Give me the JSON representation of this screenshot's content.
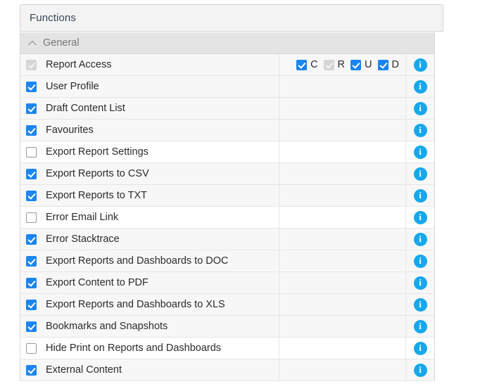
{
  "panel": {
    "title": "Functions"
  },
  "group": {
    "label": "General",
    "collapse_icon": "chevron-up-icon",
    "expanded": true
  },
  "columns": {
    "name": "",
    "permissions": "",
    "info": ""
  },
  "colors": {
    "accent_checkbox": "#1b85f3",
    "info_icon": "#16a7ec",
    "disabled_checkbox": "#d5d5d5",
    "row_shaded": "#f7f7f7",
    "group_header_bg": "#e4e4e4",
    "panel_header_bg": "#f3f3f3",
    "text": "#2b2b2b",
    "title_text": "#33475b"
  },
  "info_icon_label": "i",
  "rows": [
    {
      "label": "Report Access",
      "checked": true,
      "disabled": true,
      "shaded": true,
      "crud": [
        {
          "letter": "C",
          "checked": true,
          "disabled": false
        },
        {
          "letter": "R",
          "checked": true,
          "disabled": true
        },
        {
          "letter": "U",
          "checked": true,
          "disabled": false
        },
        {
          "letter": "D",
          "checked": true,
          "disabled": false
        }
      ],
      "info": true
    },
    {
      "label": "User Profile",
      "checked": true,
      "disabled": false,
      "shaded": true,
      "crud": [],
      "info": true
    },
    {
      "label": "Draft Content List",
      "checked": true,
      "disabled": false,
      "shaded": true,
      "crud": [],
      "info": true
    },
    {
      "label": "Favourites",
      "checked": true,
      "disabled": false,
      "shaded": true,
      "crud": [],
      "info": true
    },
    {
      "label": "Export Report Settings",
      "checked": false,
      "disabled": false,
      "shaded": false,
      "crud": [],
      "info": true
    },
    {
      "label": "Export Reports to CSV",
      "checked": true,
      "disabled": false,
      "shaded": true,
      "crud": [],
      "info": true
    },
    {
      "label": "Export Reports to TXT",
      "checked": true,
      "disabled": false,
      "shaded": true,
      "crud": [],
      "info": true
    },
    {
      "label": "Error Email Link",
      "checked": false,
      "disabled": false,
      "shaded": false,
      "crud": [],
      "info": true
    },
    {
      "label": "Error Stacktrace",
      "checked": true,
      "disabled": false,
      "shaded": true,
      "crud": [],
      "info": true
    },
    {
      "label": "Export Reports and Dashboards to DOC",
      "checked": true,
      "disabled": false,
      "shaded": true,
      "crud": [],
      "info": true
    },
    {
      "label": "Export Content to PDF",
      "checked": true,
      "disabled": false,
      "shaded": true,
      "crud": [],
      "info": true
    },
    {
      "label": "Export Reports and Dashboards to XLS",
      "checked": true,
      "disabled": false,
      "shaded": true,
      "crud": [],
      "info": true
    },
    {
      "label": "Bookmarks and Snapshots",
      "checked": true,
      "disabled": false,
      "shaded": true,
      "crud": [],
      "info": true
    },
    {
      "label": "Hide Print on Reports and Dashboards",
      "checked": false,
      "disabled": false,
      "shaded": false,
      "crud": [],
      "info": true
    },
    {
      "label": "External Content",
      "checked": true,
      "disabled": false,
      "shaded": true,
      "crud": [],
      "info": true
    }
  ]
}
